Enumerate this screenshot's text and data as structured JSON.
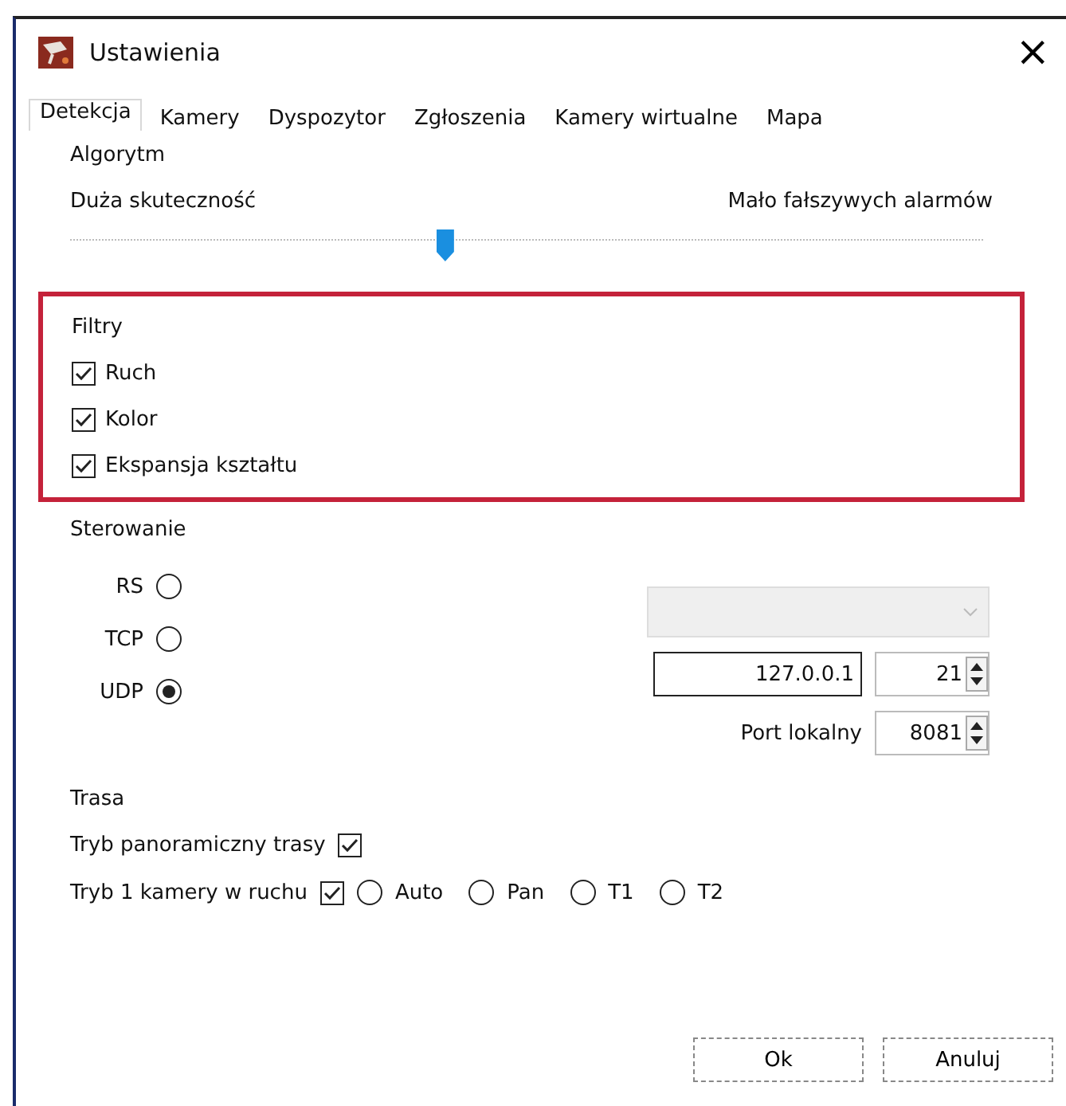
{
  "window": {
    "title": "Ustawienia",
    "close": "×"
  },
  "tabs": [
    {
      "label": "Detekcja",
      "selected": true
    },
    {
      "label": "Kamery",
      "selected": false
    },
    {
      "label": "Dyspozytor",
      "selected": false
    },
    {
      "label": "Zgłoszenia",
      "selected": false
    },
    {
      "label": "Kamery wirtualne",
      "selected": false
    },
    {
      "label": "Mapa",
      "selected": false
    }
  ],
  "algorithm": {
    "title": "Algorytm",
    "left_label": "Duża skuteczność",
    "right_label": "Mało fałszywych alarmów",
    "level": 0.41
  },
  "filters": {
    "title": "Filtry",
    "highlighted": true,
    "items": [
      {
        "label": "Ruch",
        "checked": true
      },
      {
        "label": "Kolor",
        "checked": true
      },
      {
        "label": "Ekspansja kształtu",
        "checked": true
      }
    ]
  },
  "control": {
    "title": "Sterowanie",
    "modes": [
      {
        "label": "RS",
        "selected": false
      },
      {
        "label": "TCP",
        "selected": false
      },
      {
        "label": "UDP",
        "selected": true
      }
    ],
    "port_select": {
      "disabled": true
    },
    "address": "127.0.0.1",
    "port": "21",
    "local_port_label": "Port lokalny",
    "local_port": "8081"
  },
  "route": {
    "title": "Trasa",
    "panoramic": {
      "label": "Tryb panoramiczny trasy",
      "checked": true
    },
    "single_camera": {
      "label": "Tryb 1 kamery w ruchu",
      "checked": true
    },
    "options": [
      {
        "label": "Auto",
        "selected": false
      },
      {
        "label": "Pan",
        "selected": false
      },
      {
        "label": "T1",
        "selected": false
      },
      {
        "label": "T2",
        "selected": false
      }
    ]
  },
  "buttons": [
    "Ok",
    "Anuluj"
  ]
}
